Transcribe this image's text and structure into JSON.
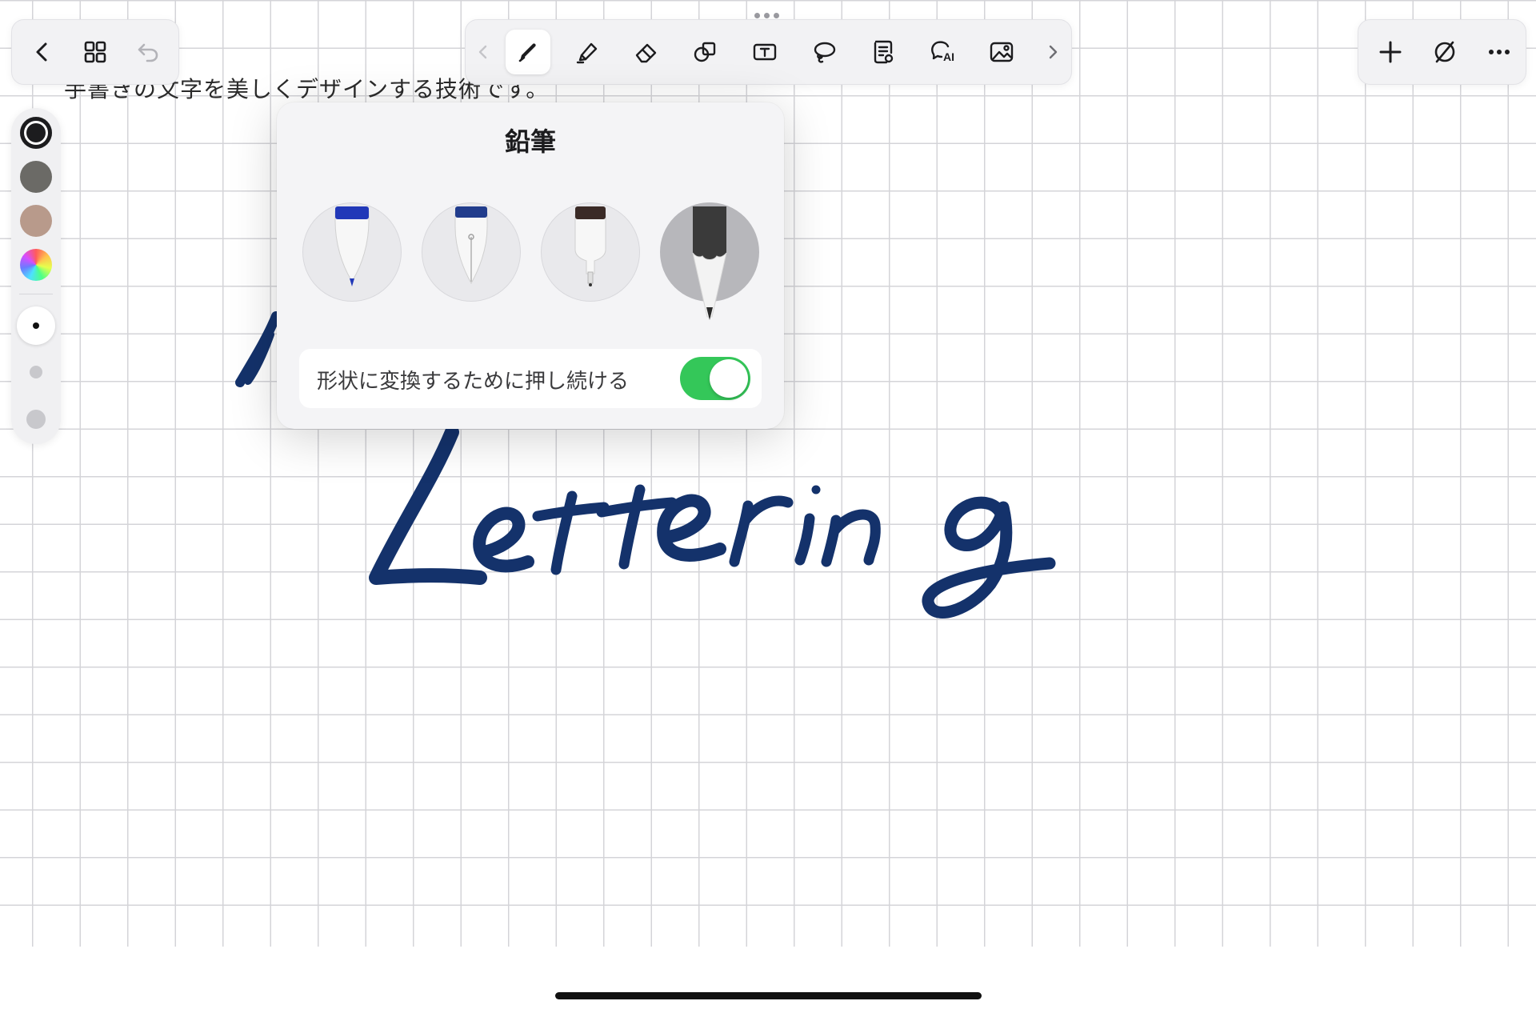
{
  "canvas": {
    "header_text": "手書きの文字を美しくデザインする技術です。",
    "handwriting_word": "Lettering",
    "ink_color": "#14326b"
  },
  "top_left_bar": {
    "buttons": [
      {
        "name": "back",
        "icon": "chevron-left-icon"
      },
      {
        "name": "grid-view",
        "icon": "grid-icon"
      },
      {
        "name": "undo",
        "icon": "undo-icon",
        "disabled": true
      }
    ]
  },
  "tool_bar": {
    "tools": [
      {
        "name": "scroll-left",
        "icon": "chevron-left-icon",
        "disabled": true
      },
      {
        "name": "pen",
        "icon": "pen-icon",
        "active": true
      },
      {
        "name": "highlighter",
        "icon": "highlighter-icon"
      },
      {
        "name": "eraser",
        "icon": "eraser-icon"
      },
      {
        "name": "shapes",
        "icon": "shapes-icon"
      },
      {
        "name": "text",
        "icon": "text-box-icon"
      },
      {
        "name": "lasso",
        "icon": "lasso-icon"
      },
      {
        "name": "sticker",
        "icon": "document-icon"
      },
      {
        "name": "ai",
        "icon": "ai-bubble-icon",
        "label": "AI"
      },
      {
        "name": "image",
        "icon": "image-icon"
      },
      {
        "name": "scroll-right",
        "icon": "chevron-right-icon"
      }
    ]
  },
  "top_right_bar": {
    "buttons": [
      {
        "name": "add",
        "icon": "plus-icon"
      },
      {
        "name": "hide-toolbar",
        "icon": "slash-circle-icon"
      },
      {
        "name": "more",
        "icon": "ellipsis-icon"
      }
    ]
  },
  "colors": {
    "swatches": [
      "#1c1c1e",
      "#6b6a66",
      "#b89a8b",
      "rainbow"
    ],
    "selected": "#1c1c1e"
  },
  "sizes": [
    "small",
    "medium",
    "large"
  ],
  "pen_popover": {
    "title": "鉛筆",
    "pen_types": [
      {
        "name": "ballpoint",
        "cap_color": "#2138b8"
      },
      {
        "name": "fountain",
        "cap_color": "#213c8c"
      },
      {
        "name": "fineliner",
        "cap_color": "#3a2a26"
      },
      {
        "name": "pencil",
        "cap_color": "#3a3a3a",
        "selected": true
      }
    ],
    "toggle": {
      "label": "形状に変換するために押し続ける",
      "on": true
    }
  }
}
